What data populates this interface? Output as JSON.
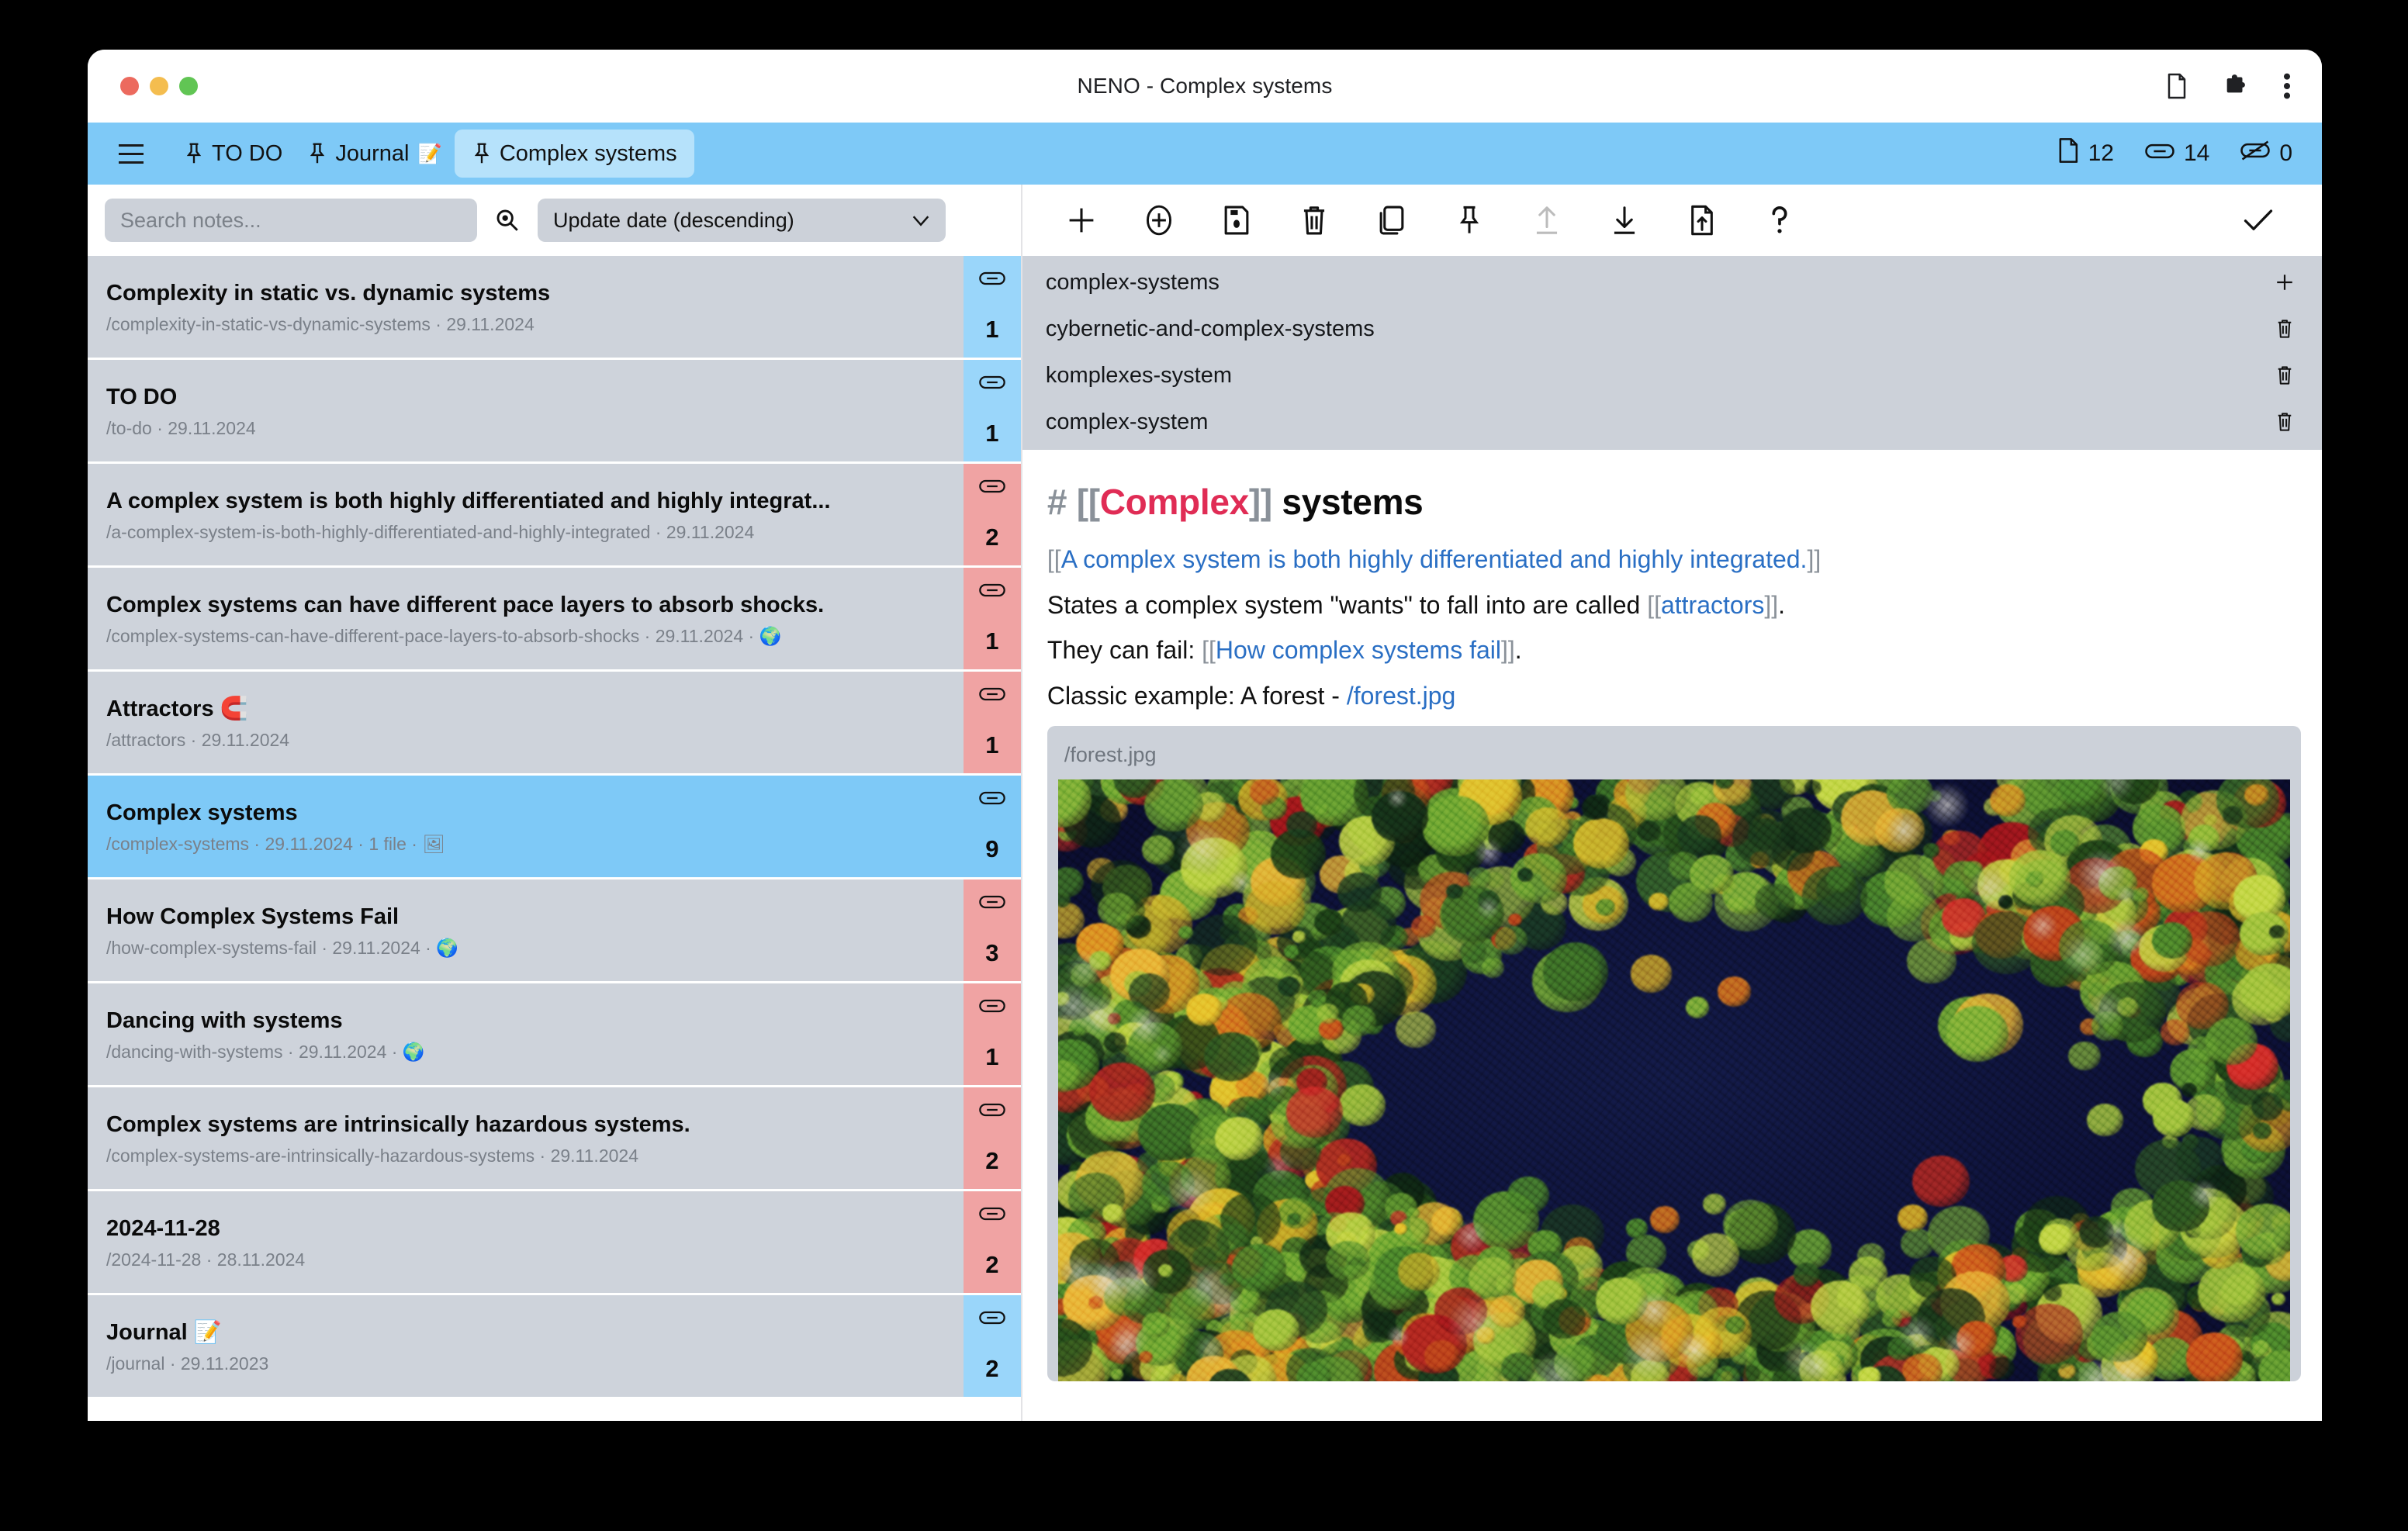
{
  "window": {
    "title": "NENO - Complex systems",
    "traffic_lights": [
      "close",
      "minimize",
      "maximize"
    ],
    "chrome_icons": [
      "page-icon",
      "extensions-puzzle-icon",
      "chrome-menu-icon"
    ]
  },
  "header": {
    "menu_icon": "hamburger-icon",
    "pinned_notes": [
      {
        "label": "TO DO",
        "emoji": "",
        "active": false
      },
      {
        "label": "Journal",
        "emoji": "📝",
        "active": false
      },
      {
        "label": "Complex systems",
        "emoji": "",
        "active": true
      }
    ],
    "stats": [
      {
        "icon": "document-icon",
        "value": "12"
      },
      {
        "icon": "link-icon",
        "value": "14"
      },
      {
        "icon": "unlinked-icon",
        "value": "0"
      }
    ]
  },
  "search": {
    "placeholder": "Search notes...",
    "value": "",
    "icon": "search-icon",
    "sort_value": "Update date (descending)",
    "sort_options": [
      "Update date (descending)"
    ]
  },
  "notes": [
    {
      "title": "Complexity in static vs. dynamic systems",
      "slug": "/complexity-in-static-vs-dynamic-systems",
      "date": "29.11.2024",
      "extra": "",
      "links": "1",
      "badge": "blue",
      "selected": false
    },
    {
      "title": "TO DO",
      "slug": "/to-do",
      "date": "29.11.2024",
      "extra": "",
      "links": "1",
      "badge": "blue",
      "selected": false
    },
    {
      "title": "A complex system is both highly differentiated and highly integrat...",
      "slug": "/a-complex-system-is-both-highly-differentiated-and-highly-integrated",
      "date": "29.11.2024",
      "extra": "",
      "links": "2",
      "badge": "pink",
      "selected": false
    },
    {
      "title": "Complex systems can have different pace layers to absorb shocks.",
      "slug": "/complex-systems-can-have-different-pace-layers-to-absorb-shocks",
      "date": "29.11.2024",
      "extra": "🌍",
      "links": "1",
      "badge": "pink",
      "selected": false
    },
    {
      "title": "Attractors 🧲",
      "slug": "/attractors",
      "date": "29.11.2024",
      "extra": "",
      "links": "1",
      "badge": "pink",
      "selected": false
    },
    {
      "title": "Complex systems",
      "slug": "/complex-systems",
      "date": "29.11.2024",
      "extra": "1 file · 🖼",
      "links": "9",
      "badge": "sel",
      "selected": true
    },
    {
      "title": "How Complex Systems Fail",
      "slug": "/how-complex-systems-fail",
      "date": "29.11.2024",
      "extra": "🌍",
      "links": "3",
      "badge": "pink",
      "selected": false
    },
    {
      "title": "Dancing with systems",
      "slug": "/dancing-with-systems",
      "date": "29.11.2024",
      "extra": "🌍",
      "links": "1",
      "badge": "pink",
      "selected": false
    },
    {
      "title": "Complex systems are intrinsically hazardous systems.",
      "slug": "/complex-systems-are-intrinsically-hazardous-systems",
      "date": "29.11.2024",
      "extra": "",
      "links": "2",
      "badge": "pink",
      "selected": false
    },
    {
      "title": "2024-11-28",
      "slug": "/2024-11-28",
      "date": "28.11.2024",
      "extra": "",
      "links": "2",
      "badge": "pink",
      "selected": false
    },
    {
      "title": "Journal 📝",
      "slug": "/journal",
      "date": "29.11.2023",
      "extra": "",
      "links": "2",
      "badge": "blue",
      "selected": false
    }
  ],
  "editor_toolbar": [
    {
      "name": "new-note-button",
      "icon": "plus-icon",
      "disabled": false
    },
    {
      "name": "duplicate-note-button",
      "icon": "plus-circle-icon",
      "disabled": false
    },
    {
      "name": "save-note-button",
      "icon": "save-icon",
      "disabled": false
    },
    {
      "name": "delete-note-button",
      "icon": "trash-icon",
      "disabled": false
    },
    {
      "name": "copy-note-button",
      "icon": "copy-icon",
      "disabled": false
    },
    {
      "name": "pin-note-button",
      "icon": "pin-icon",
      "disabled": false
    },
    {
      "name": "upload-file-button",
      "icon": "upload-icon",
      "disabled": true
    },
    {
      "name": "download-note-button",
      "icon": "download-icon",
      "disabled": false
    },
    {
      "name": "import-file-button",
      "icon": "file-upload-icon",
      "disabled": false
    },
    {
      "name": "help-button",
      "icon": "question-mark-icon",
      "disabled": false
    }
  ],
  "toolbar_confirm": {
    "name": "confirm-button",
    "icon": "checkmark-icon"
  },
  "slugs": [
    {
      "text": "complex-systems",
      "action": "add-slug-icon",
      "primary": true
    },
    {
      "text": "cybernetic-and-complex-systems",
      "action": "delete-slug-icon",
      "primary": false
    },
    {
      "text": "komplexes-system",
      "action": "delete-slug-icon",
      "primary": false
    },
    {
      "text": "complex-system",
      "action": "delete-slug-icon",
      "primary": false
    }
  ],
  "note": {
    "heading": {
      "hash": "#",
      "open_brackets": "[[",
      "link_text": "Complex",
      "close_brackets": "]]",
      "rest": " systems"
    },
    "paragraphs": [
      {
        "segments": [
          {
            "type": "bracket",
            "text": "[["
          },
          {
            "type": "link",
            "text": "A complex system is both highly differentiated and highly integrated."
          },
          {
            "type": "bracket",
            "text": "]]"
          }
        ]
      },
      {
        "segments": [
          {
            "type": "text",
            "text": "States a complex system \"wants\" to fall into are called "
          },
          {
            "type": "bracket",
            "text": "[["
          },
          {
            "type": "link",
            "text": "attractors"
          },
          {
            "type": "bracket",
            "text": "]]"
          },
          {
            "type": "text",
            "text": "."
          }
        ]
      },
      {
        "segments": [
          {
            "type": "text",
            "text": "They can fail: "
          },
          {
            "type": "bracket",
            "text": "[["
          },
          {
            "type": "link",
            "text": "How complex systems fail"
          },
          {
            "type": "bracket",
            "text": "]]"
          },
          {
            "type": "text",
            "text": "."
          }
        ]
      },
      {
        "segments": [
          {
            "type": "text",
            "text": "Classic example: A forest - "
          },
          {
            "type": "filelink",
            "text": "/forest.jpg"
          }
        ]
      }
    ],
    "attachment": {
      "filename": "/forest.jpg",
      "alt": "aerial photo of an autumn forest beside a dark river"
    }
  },
  "colors": {
    "accent_blue": "#7ec9f7",
    "badge_blue": "#9ad6fa",
    "badge_pink": "#f0a3a3",
    "list_bg": "#ced3db",
    "wikilink_blue": "#2a6fc4",
    "heading_link_red": "#e02c55",
    "muted_text": "#7a8089"
  }
}
